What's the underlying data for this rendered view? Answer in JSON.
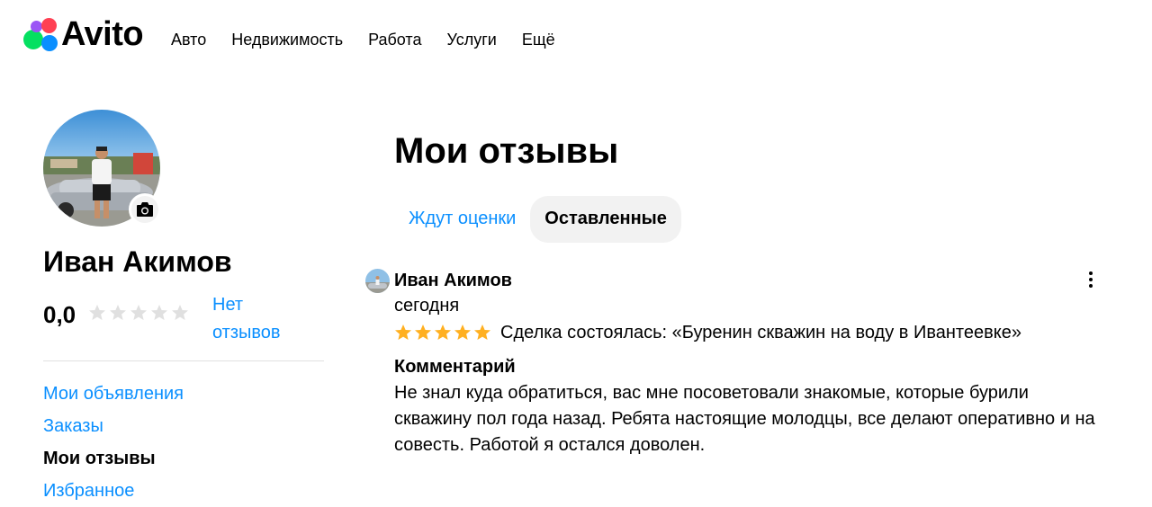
{
  "header": {
    "logo_text": "Avito",
    "brand_colors": {
      "green": "#04e061",
      "blue": "#0a8fff",
      "purple": "#9b55f5",
      "red": "#ff4053"
    },
    "nav": [
      {
        "label": "Авто"
      },
      {
        "label": "Недвижимость"
      },
      {
        "label": "Работа"
      },
      {
        "label": "Услуги"
      },
      {
        "label": "Ещё"
      }
    ]
  },
  "profile": {
    "name": "Иван Акимов",
    "rating": "0,0",
    "rating_stars": 0,
    "no_reviews": "Нет отзывов",
    "camera_icon": "camera-icon"
  },
  "side_menu": [
    {
      "label": "Мои объявления",
      "active": false
    },
    {
      "label": "Заказы",
      "active": false
    },
    {
      "label": "Мои отзывы",
      "active": true
    },
    {
      "label": "Избранное",
      "active": false
    }
  ],
  "main": {
    "title": "Мои отзывы",
    "tabs": [
      {
        "label": "Ждут оценки",
        "active": false
      },
      {
        "label": "Оставленные",
        "active": true
      }
    ]
  },
  "review": {
    "author": "Иван Акимов",
    "date": "сегодня",
    "stars": 5,
    "deal": "Сделка состоялась: «Буренин скважин на воду в Ивантеевке»",
    "comment_title": "Комментарий",
    "comment_text": "Не знал куда обратиться, вас мне посоветовали знакомые, которые бурили скважину пол года назад. Ребята настоящие молодцы, все делают оперативно и на совесть. Работой я остался доволен."
  },
  "colors": {
    "link": "#0a8fff",
    "star_gold": "#ffb021",
    "star_gray": "#e0e0e0",
    "tab_active_bg": "#f2f2f2"
  }
}
